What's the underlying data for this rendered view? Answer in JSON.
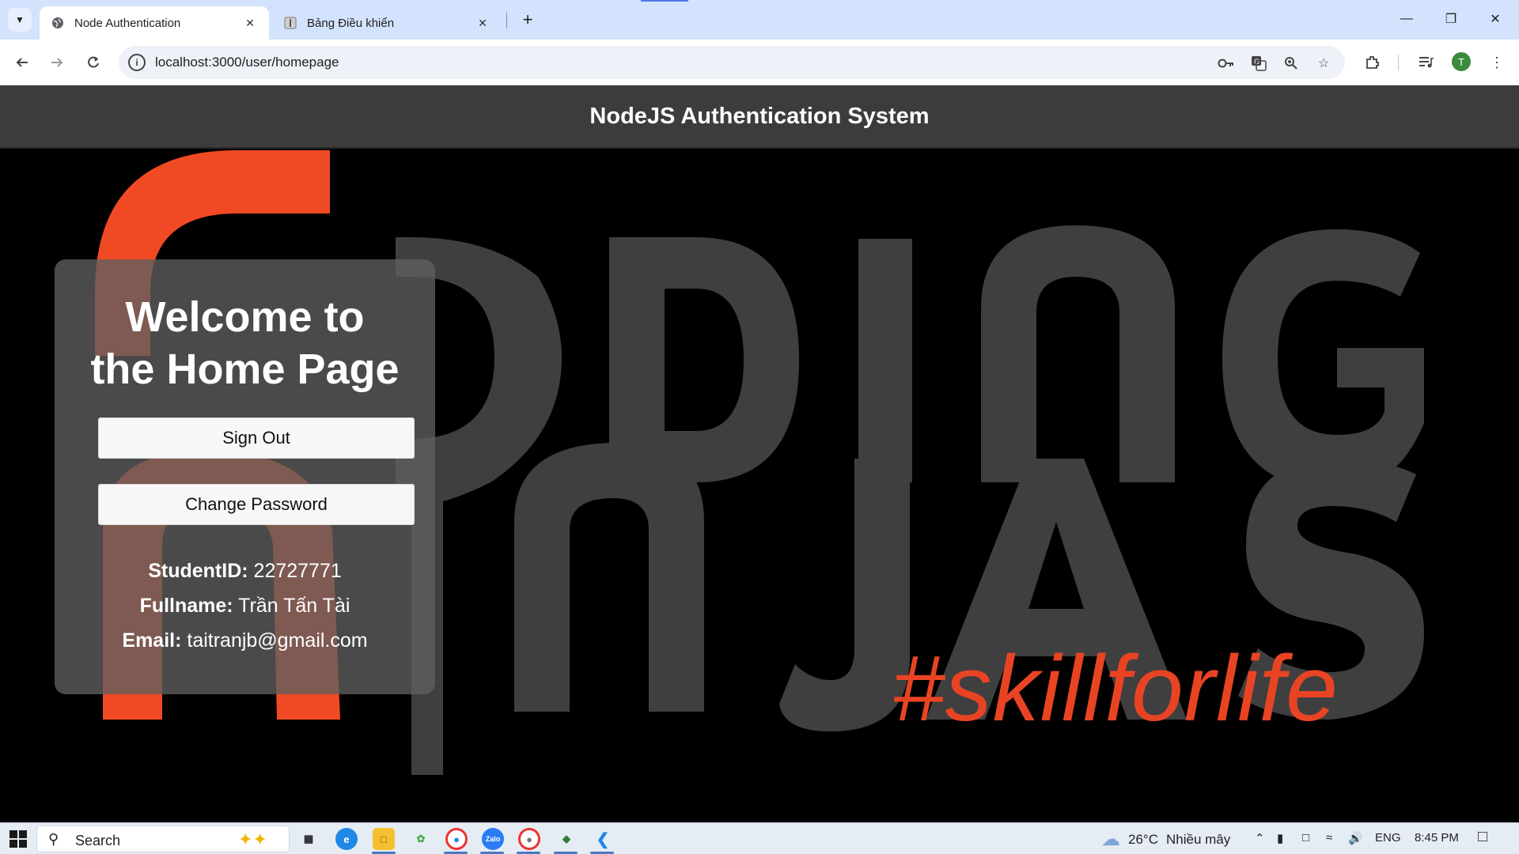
{
  "browser": {
    "tabs": [
      {
        "title": "Node Authentication",
        "active": true
      },
      {
        "title": "Bảng Điều khiển",
        "active": false
      }
    ],
    "url": "localhost:3000/user/homepage",
    "profile_initial": "T"
  },
  "page": {
    "header_title": "NodeJS Authentication System",
    "welcome_heading_line1": "Welcome to",
    "welcome_heading_line2": "the Home Page",
    "sign_out_label": "Sign Out",
    "change_password_label": "Change Password",
    "student_id_label": "StudentID:",
    "student_id_value": " 22727771",
    "fullname_label": "Fullname:",
    "fullname_value": " Trần Tấn Tài",
    "email_label": "Email:",
    "email_value": " taitranjb@gmail.com",
    "background_tagline": "#skillforlife",
    "accent_color": "#e84424"
  },
  "taskbar": {
    "search_placeholder": "Search",
    "weather_temp": "26°C",
    "weather_desc": "Nhiều mây",
    "language": "ENG",
    "time": "8:45 PM"
  }
}
